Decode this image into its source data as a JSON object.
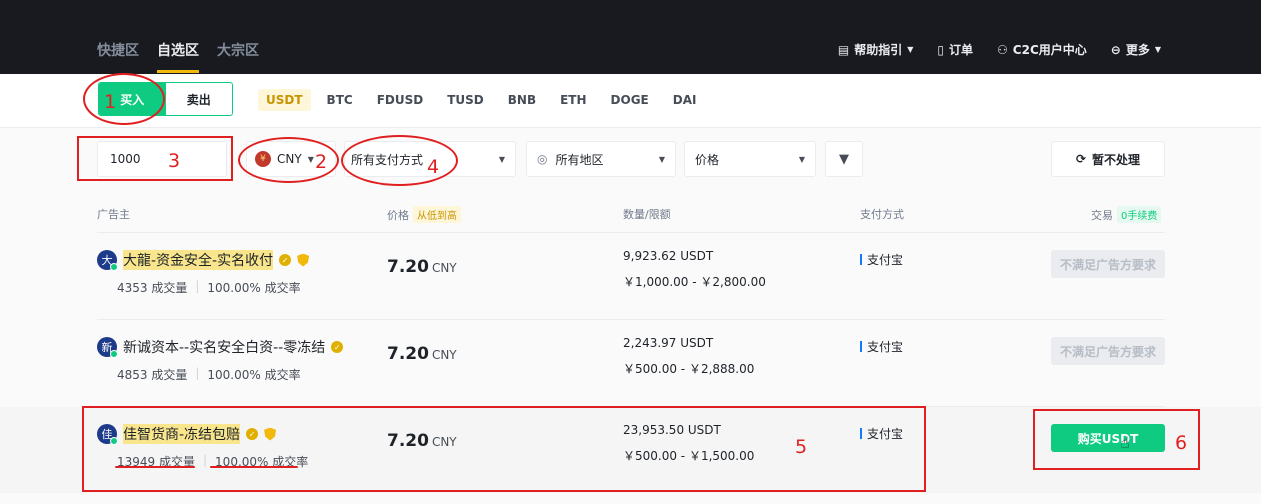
{
  "topnav": {
    "tabs": [
      "快捷区",
      "自选区",
      "大宗区"
    ],
    "active_tab": "自选区",
    "right": {
      "help": "帮助指引",
      "orders": "订单",
      "c2c": "C2C用户中心",
      "more": "更多"
    }
  },
  "trade": {
    "buy_label": "买入",
    "sell_label": "卖出",
    "coins": [
      "USDT",
      "BTC",
      "FDUSD",
      "TUSD",
      "BNB",
      "ETH",
      "DOGE",
      "DAI"
    ],
    "active_coin": "USDT"
  },
  "filters": {
    "amount_value": "1000",
    "currency": "CNY",
    "currency_symbol": "¥",
    "payment": "所有支付方式",
    "region": "所有地区",
    "sort": "价格",
    "refresh": "暂不处理"
  },
  "table": {
    "headers": {
      "advertiser": "广告主",
      "price": "价格",
      "price_tag": "从低到高",
      "qty": "数量/限额",
      "payment": "支付方式",
      "trade": "交易",
      "trade_tag": "0手续费"
    },
    "rows": [
      {
        "avatar": "大",
        "name": "大龍-资金安全-实名收付",
        "orders": "4353 成交量",
        "rate": "100.00% 成交率",
        "price": "7.20",
        "unit": "CNY",
        "qty": "9,923.62 USDT",
        "limit": "￥1,000.00 - ￥2,800.00",
        "payment": "支付宝",
        "action": "不满足广告方要求"
      },
      {
        "avatar": "新",
        "name": "新诚资本--实名安全白资--零冻结",
        "orders": "4853 成交量",
        "rate": "100.00% 成交率",
        "price": "7.20",
        "unit": "CNY",
        "qty": "2,243.97 USDT",
        "limit": "￥500.00 - ￥2,888.00",
        "payment": "支付宝",
        "action": "不满足广告方要求"
      },
      {
        "avatar": "佳",
        "name": "佳智货商-冻结包赔",
        "orders": "13949 成交量",
        "rate": "100.00% 成交率",
        "price": "7.20",
        "unit": "CNY",
        "qty": "23,953.50 USDT",
        "limit": "￥500.00 - ￥1,500.00",
        "payment": "支付宝",
        "action": "购买USDT"
      }
    ]
  },
  "annotations": [
    "1",
    "2",
    "3",
    "4",
    "5",
    "6"
  ],
  "colors": {
    "topbar": "#181a20",
    "accent_green": "#0ecb81",
    "accent_yellow": "#f0b90b",
    "annotation_red": "#e02020"
  }
}
